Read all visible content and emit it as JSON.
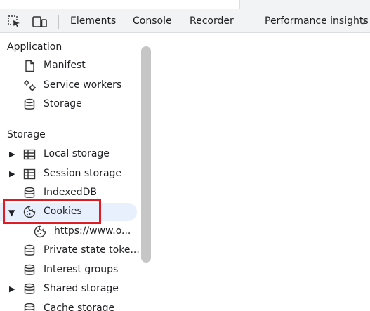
{
  "toolbar": {
    "tabs": [
      "Elements",
      "Console",
      "Recorder",
      "Performance insights"
    ],
    "more_glyph": "›",
    "icons": [
      "inspect-element-icon",
      "device-toolbar-icon"
    ]
  },
  "sidebar": {
    "application_header": "Application",
    "application_items": [
      "Manifest",
      "Service workers",
      "Storage"
    ],
    "storage_header": "Storage",
    "storage_items": [
      {
        "label": "Local storage",
        "expandable": true,
        "expanded": false
      },
      {
        "label": "Session storage",
        "expandable": true,
        "expanded": false
      },
      {
        "label": "IndexedDB",
        "expandable": false
      },
      {
        "label": "Cookies",
        "expandable": true,
        "expanded": true,
        "selected": true
      },
      {
        "label": "https://www.o...",
        "child": true
      },
      {
        "label": "Private state toke...",
        "expandable": false
      },
      {
        "label": "Interest groups",
        "expandable": false
      },
      {
        "label": "Shared storage",
        "expandable": true,
        "expanded": false
      },
      {
        "label": "Cache storage",
        "expandable": false
      }
    ],
    "arrow_collapsed": "▶",
    "arrow_expanded": "▼"
  },
  "colors": {
    "accent_selected_bg": "#e8f0fe",
    "highlight_box": "#e01b24",
    "toolbar_bg": "#f1f3f4"
  }
}
